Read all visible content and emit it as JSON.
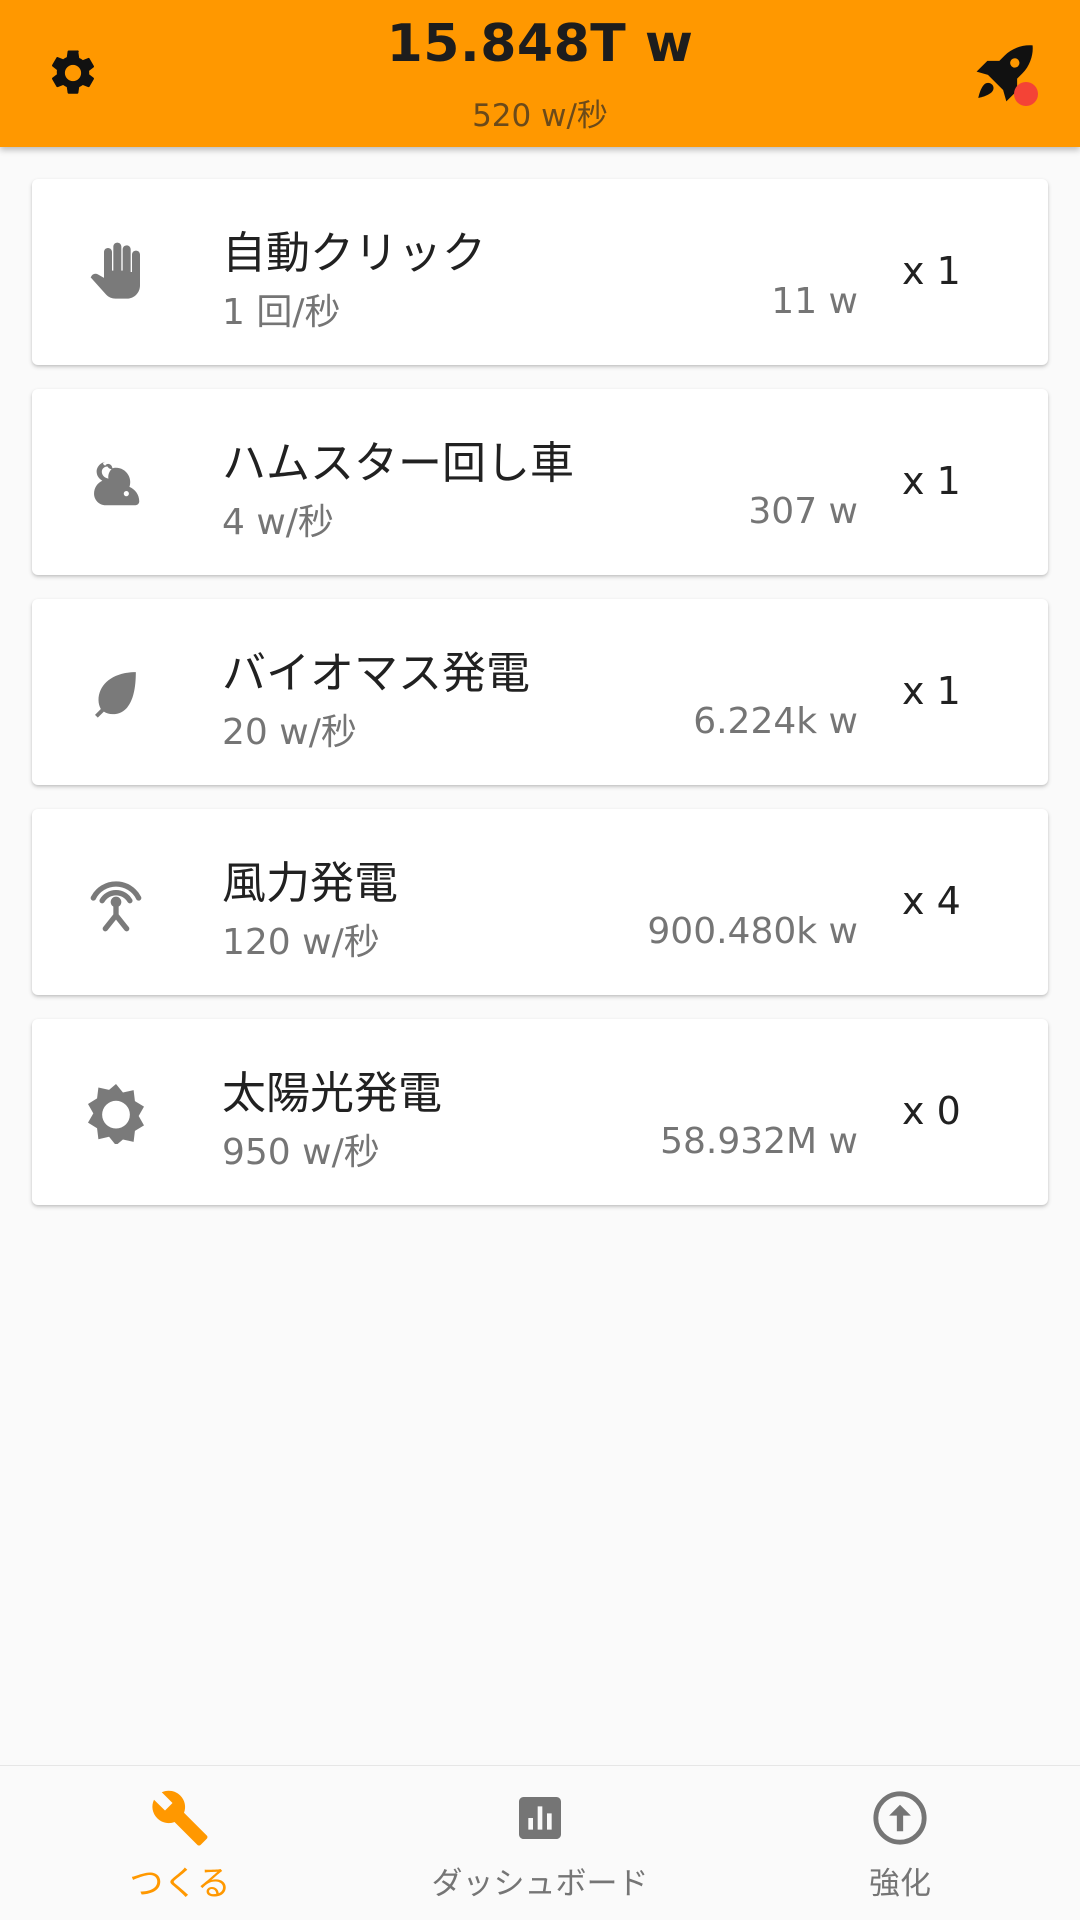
{
  "header": {
    "total": "15.848T w",
    "rate": "520 w/秒",
    "left_icon": "settings-gear-icon",
    "right_icon": "rocket-icon",
    "badge_color": "#f44336",
    "accent": "#ff9800"
  },
  "generators": [
    {
      "icon": "hand-icon",
      "name": "自動クリック",
      "per": "1 回/秒",
      "cost": "11 w",
      "count": "x 1"
    },
    {
      "icon": "hamster-icon",
      "name": "ハムスター回し車",
      "per": "4 w/秒",
      "cost": "307 w",
      "count": "x 1"
    },
    {
      "icon": "leaf-icon",
      "name": "バイオマス発電",
      "per": "20 w/秒",
      "cost": "6.224k w",
      "count": "x 1"
    },
    {
      "icon": "wind-tower-icon",
      "name": "風力発電",
      "per": "120 w/秒",
      "cost": "900.480k w",
      "count": "x 4"
    },
    {
      "icon": "sun-icon",
      "name": "太陽光発電",
      "per": "950 w/秒",
      "cost": "58.932M w",
      "count": "x 0"
    }
  ],
  "bottom_nav": {
    "items": [
      {
        "label": "つくる",
        "icon": "wrench-icon",
        "active": true
      },
      {
        "label": "ダッシュボード",
        "icon": "bar-chart-icon",
        "active": false
      },
      {
        "label": "強化",
        "icon": "upgrade-arrow-icon",
        "active": false
      }
    ]
  }
}
